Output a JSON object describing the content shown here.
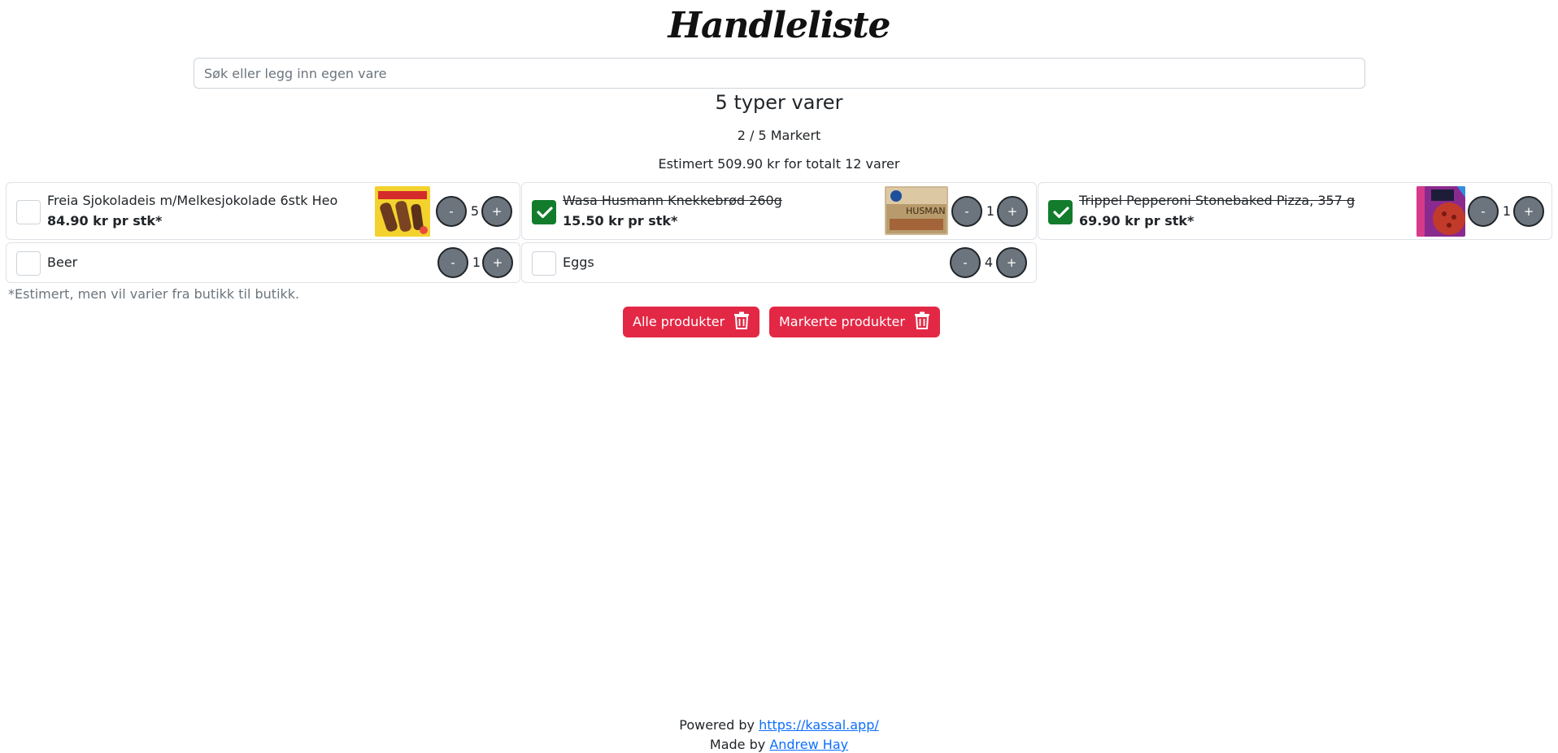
{
  "app": {
    "title": "Handleliste"
  },
  "search": {
    "placeholder": "Søk eller legg inn egen vare"
  },
  "summary": {
    "types_text": "5 typer varer",
    "marked_text": "2 / 5 Markert",
    "estimate_text": "Estimert 509.90 kr for totalt 12 varer"
  },
  "items": [
    {
      "name": "Freia Sjokoladeis m/Melkesjokolade 6stk Heo",
      "price": "84.90 kr pr stk*",
      "quantity": "5",
      "checked": false,
      "minus": "-",
      "plus": "+"
    },
    {
      "name": "Wasa Husmann Knekkebrød 260g",
      "price": "15.50 kr pr stk*",
      "quantity": "1",
      "checked": true,
      "minus": "-",
      "plus": "+"
    },
    {
      "name": "Trippel Pepperoni Stonebaked Pizza, 357 g",
      "price": "69.90 kr pr stk*",
      "quantity": "1",
      "checked": true,
      "minus": "-",
      "plus": "+"
    },
    {
      "name": "Beer",
      "quantity": "1",
      "checked": false,
      "minus": "-",
      "plus": "+"
    },
    {
      "name": "Eggs",
      "quantity": "4",
      "checked": false,
      "minus": "-",
      "plus": "+"
    }
  ],
  "note": "*Estimert, men vil varier fra butikk til butikk.",
  "actions": {
    "delete_all_label": "Alle produkter",
    "delete_marked_label": "Markerte produkter"
  },
  "footer": {
    "powered_by_prefix": "Powered by",
    "powered_by_link": "https://kassal.app/",
    "made_by_prefix": "Made by",
    "made_by_link": "Andrew Hay"
  },
  "colors": {
    "danger": "#e32845",
    "checked": "#127c2c",
    "qty_button": "#6c757d",
    "link": "#0d6efd"
  }
}
